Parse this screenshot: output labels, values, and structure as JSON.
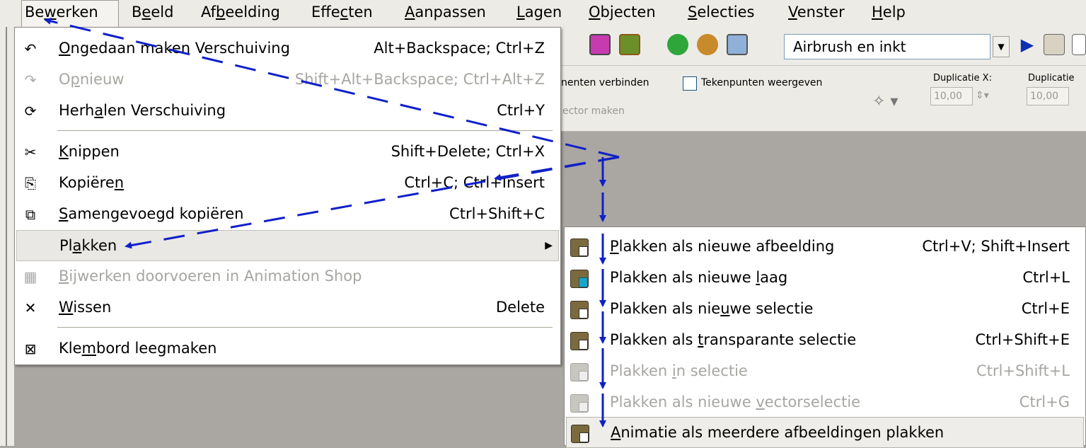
{
  "menubar": {
    "items": [
      {
        "pre": "Be",
        "u": "w",
        "post": "erken",
        "active": true
      },
      {
        "pre": "B",
        "u": "e",
        "post": "eld"
      },
      {
        "pre": "Af",
        "u": "b",
        "post": "eelding"
      },
      {
        "pre": "Effe",
        "u": "c",
        "post": "ten"
      },
      {
        "pre": "",
        "u": "A",
        "post": "anpassen"
      },
      {
        "pre": "",
        "u": "L",
        "post": "agen"
      },
      {
        "pre": "",
        "u": "O",
        "post": "bjecten"
      },
      {
        "pre": "",
        "u": "S",
        "post": "electies"
      },
      {
        "pre": "",
        "u": "V",
        "post": "enster"
      },
      {
        "pre": "",
        "u": "H",
        "post": "elp"
      }
    ]
  },
  "toolbar": {
    "brush_preset": "Airbrush en inkt"
  },
  "props": {
    "connect_label": "nenten verbinden",
    "show_points_label": "Tekenpunten weergeven",
    "vector_label": "ector maken",
    "dup_x_label": "Duplicatie X:",
    "dup_y_label": "Duplicatie",
    "dup_x_value": "10,00",
    "dup_y_value": "10,00"
  },
  "menu": {
    "items": [
      {
        "type": "item",
        "icon": "undo-icon",
        "glyph": "↶",
        "pre": "",
        "u": "O",
        "post": "ngedaan maken Verschuiving",
        "shortcut": "Alt+Backspace; Ctrl+Z"
      },
      {
        "type": "item",
        "icon": "redo-icon",
        "glyph": "↷",
        "pre": "O",
        "u": "p",
        "post": "nieuw",
        "shortcut": "Shift+Alt+Backspace; Ctrl+Alt+Z",
        "disabled": true
      },
      {
        "type": "item",
        "icon": "repeat-icon",
        "glyph": "⟳",
        "pre": "Herh",
        "u": "a",
        "post": "len  Verschuiving",
        "shortcut": "Ctrl+Y"
      },
      {
        "type": "sep"
      },
      {
        "type": "item",
        "icon": "scissors-icon",
        "glyph": "✂",
        "pre": "",
        "u": "K",
        "post": "nippen",
        "shortcut": "Shift+Delete; Ctrl+X"
      },
      {
        "type": "item",
        "icon": "copy-icon",
        "glyph": "⎘",
        "pre": "Kopiëre",
        "u": "n",
        "post": "",
        "shortcut": "Ctrl+C; Ctrl+Insert"
      },
      {
        "type": "item",
        "icon": "copy-merged-icon",
        "glyph": "⧉",
        "pre": "",
        "u": "S",
        "post": "amengevoegd kopiëren",
        "shortcut": "Ctrl+Shift+C"
      },
      {
        "type": "item",
        "icon": "",
        "glyph": "",
        "pre": "Pl",
        "u": "a",
        "post": "kken",
        "shortcut": "",
        "submenu": true,
        "highlighted": true
      },
      {
        "type": "item",
        "icon": "animation-shop-icon",
        "glyph": "▦",
        "pre": "",
        "u": "B",
        "post": "ijwerken doorvoeren in Animation Shop",
        "shortcut": "",
        "disabled": true
      },
      {
        "type": "item",
        "icon": "delete-icon",
        "glyph": "✕",
        "pre": "",
        "u": "W",
        "post": "issen",
        "shortcut": "Delete"
      },
      {
        "type": "sep"
      },
      {
        "type": "item",
        "icon": "clear-clipboard-icon",
        "glyph": "⊠",
        "pre": "Kle",
        "u": "m",
        "post": "bord leegmaken",
        "shortcut": ""
      }
    ]
  },
  "submenu": {
    "items": [
      {
        "pre": "",
        "u": "P",
        "post": "lakken als nieuwe afbeelding",
        "shortcut": "Ctrl+V; Shift+Insert"
      },
      {
        "pre": "Plakken als nieuwe ",
        "u": "l",
        "post": "aag",
        "shortcut": "Ctrl+L",
        "variant": "teal"
      },
      {
        "pre": "Plakken als nie",
        "u": "u",
        "post": "we selectie",
        "shortcut": "Ctrl+E"
      },
      {
        "pre": "Plakken als ",
        "u": "t",
        "post": "ransparante selectie",
        "shortcut": "Ctrl+Shift+E"
      },
      {
        "pre": "Plakken ",
        "u": "i",
        "post": "n selectie",
        "shortcut": "Ctrl+Shift+L",
        "disabled": true
      },
      {
        "pre": "Plakken als nieuwe ",
        "u": "v",
        "post": "ectorselectie",
        "shortcut": "Ctrl+G",
        "disabled": true
      },
      {
        "pre": "",
        "u": "A",
        "post": "nimatie als meerdere afbeeldingen plakken",
        "shortcut": "",
        "highlighted": true
      }
    ]
  },
  "colors": {
    "arrow": "#1020c8",
    "menu_bg": "#ffffff",
    "disabled_text": "#a7a6a1",
    "workspace": "#aaa6a2"
  }
}
